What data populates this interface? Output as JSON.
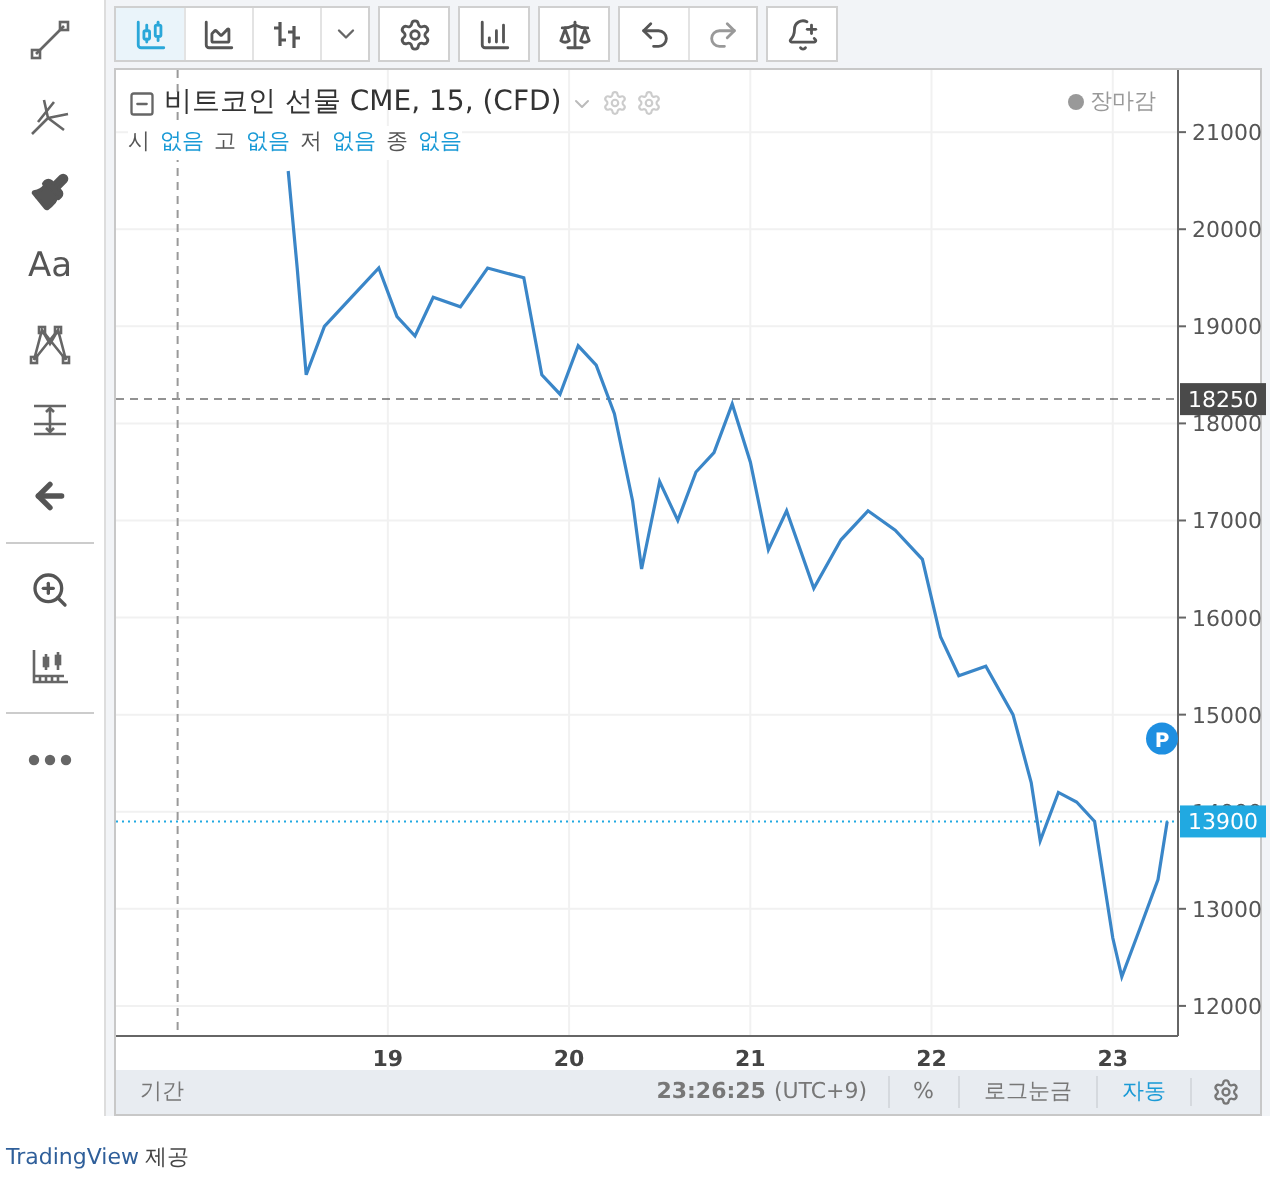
{
  "left_tools": [
    {
      "kind": "line"
    },
    {
      "kind": "pitchfork"
    },
    {
      "kind": "brush"
    },
    {
      "kind": "text",
      "label": "Aa"
    },
    {
      "kind": "pattern"
    },
    {
      "kind": "measure"
    },
    {
      "kind": "arrow"
    },
    {
      "kind": "divider"
    },
    {
      "kind": "zoom"
    },
    {
      "kind": "ruler"
    },
    {
      "kind": "divider"
    },
    {
      "kind": "more"
    }
  ],
  "top_toolbar": [
    {
      "group": [
        {
          "kind": "candles",
          "selected": true
        },
        {
          "kind": "area",
          "selected": false
        },
        {
          "kind": "bars",
          "selected": false
        },
        {
          "kind": "caret",
          "selected": false
        }
      ]
    },
    {
      "group": [
        {
          "kind": "settings",
          "selected": false
        }
      ]
    },
    {
      "group": [
        {
          "kind": "indicators",
          "selected": false
        }
      ]
    },
    {
      "group": [
        {
          "kind": "compare",
          "selected": false
        }
      ]
    },
    {
      "group": [
        {
          "kind": "undo",
          "selected": false
        },
        {
          "kind": "redo",
          "selected": false
        }
      ]
    },
    {
      "group": [
        {
          "kind": "alert",
          "selected": false
        }
      ]
    }
  ],
  "legend": {
    "title": "비트코인 선물 CME, 15, (CFD)",
    "status": "장마감",
    "ohlc": [
      {
        "label": "시",
        "value": "없음"
      },
      {
        "label": "고",
        "value": "없음"
      },
      {
        "label": "저",
        "value": "없음"
      },
      {
        "label": "종",
        "value": "없음"
      }
    ]
  },
  "chart_data": {
    "type": "line",
    "x": [
      18.45,
      18.5,
      18.55,
      18.65,
      18.8,
      18.95,
      19.05,
      19.15,
      19.25,
      19.4,
      19.55,
      19.75,
      19.85,
      19.95,
      20.05,
      20.15,
      20.25,
      20.35,
      20.4,
      20.5,
      20.6,
      20.7,
      20.8,
      20.9,
      21.0,
      21.1,
      21.2,
      21.35,
      21.5,
      21.65,
      21.8,
      21.95,
      22.05,
      22.15,
      22.3,
      22.45,
      22.55,
      22.6,
      22.7,
      22.8,
      22.9,
      23.0,
      23.05,
      23.15,
      23.25,
      23.3
    ],
    "series": [
      {
        "color": "#3a86c8",
        "values": [
          20600,
          19600,
          18500,
          19000,
          19300,
          19600,
          19100,
          18900,
          19300,
          19200,
          19600,
          19500,
          18500,
          18300,
          18800,
          18600,
          18100,
          17200,
          16500,
          17400,
          17000,
          17500,
          17700,
          18200,
          17600,
          16700,
          17100,
          16300,
          16800,
          17100,
          16900,
          16600,
          15800,
          15400,
          15500,
          15000,
          14300,
          13700,
          14200,
          14100,
          13900,
          12700,
          12300,
          12800,
          13300,
          13900
        ]
      }
    ],
    "xticks": [
      19,
      20,
      21,
      22,
      23
    ],
    "yticks": [
      12000,
      13000,
      14000,
      15000,
      16000,
      17000,
      18000,
      19000,
      20000,
      21000
    ],
    "ylim": [
      11690,
      21640
    ],
    "xlim": [
      17.5,
      23.36
    ],
    "grid": true,
    "ref_lines": [
      {
        "axis": "y",
        "value": 18250,
        "label": "18250",
        "color": "#4a4a4a"
      },
      {
        "axis": "y",
        "value": 13900,
        "label": "13900",
        "color": "#21a9e1"
      },
      {
        "axis": "x",
        "value": 17.84,
        "color": "#999999"
      }
    ]
  },
  "price_badge": "P",
  "bottom_bar": {
    "range_label": "기간",
    "time": "23:26:25",
    "timezone": "(UTC+9)",
    "options": [
      {
        "label": "%",
        "selected": false
      },
      {
        "label": "로그눈금",
        "selected": false
      },
      {
        "label": "자동",
        "selected": true
      }
    ]
  },
  "footer": {
    "link": "TradingView",
    "text": "제공"
  }
}
